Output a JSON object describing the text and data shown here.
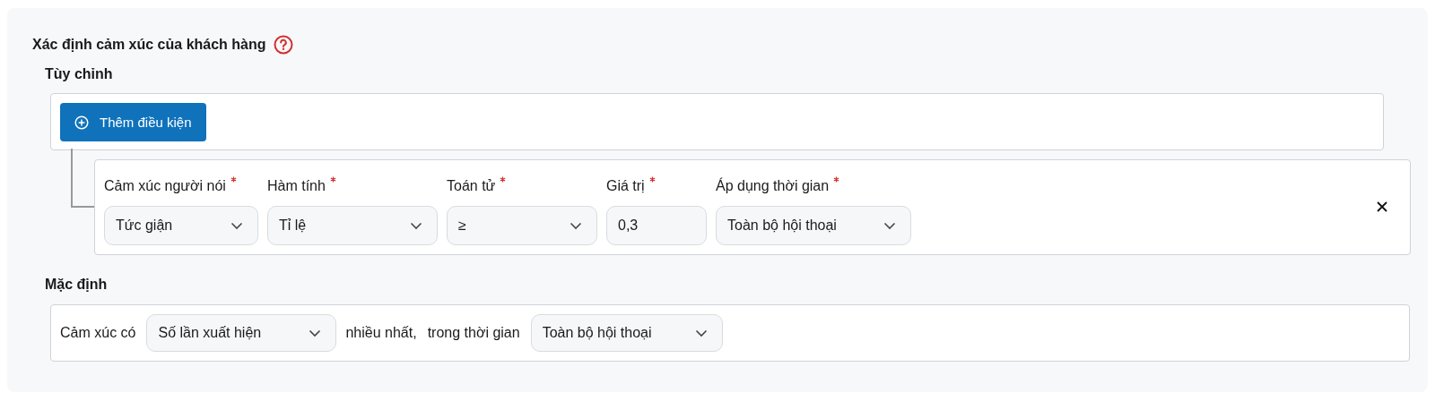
{
  "title": "Xác định cảm xúc của khách hàng",
  "custom": {
    "heading": "Tùy chỉnh",
    "add_button": "Thêm điều kiện",
    "fields": [
      {
        "kind": "select",
        "label": "Cảm xúc người nói",
        "required": true,
        "value": "Tức giận"
      },
      {
        "kind": "select",
        "label": "Hàm tính",
        "required": true,
        "value": "Tỉ lệ"
      },
      {
        "kind": "select",
        "label": "Toán tử",
        "required": true,
        "value": "≥"
      },
      {
        "kind": "input",
        "label": "Giá trị",
        "required": true,
        "value": "0,3"
      },
      {
        "kind": "select",
        "label": "Áp dụng thời gian",
        "required": true,
        "value": "Toàn bộ hội thoại"
      }
    ]
  },
  "default": {
    "heading": "Mặc định",
    "parts": [
      {
        "kind": "text",
        "text": "Cảm xúc có"
      },
      {
        "kind": "select",
        "value": "Số lần xuất hiện"
      },
      {
        "kind": "text",
        "text": "nhiều nhất,"
      },
      {
        "kind": "text",
        "text": "trong thời gian"
      },
      {
        "kind": "select",
        "value": "Toàn bộ hội thoại"
      }
    ]
  }
}
